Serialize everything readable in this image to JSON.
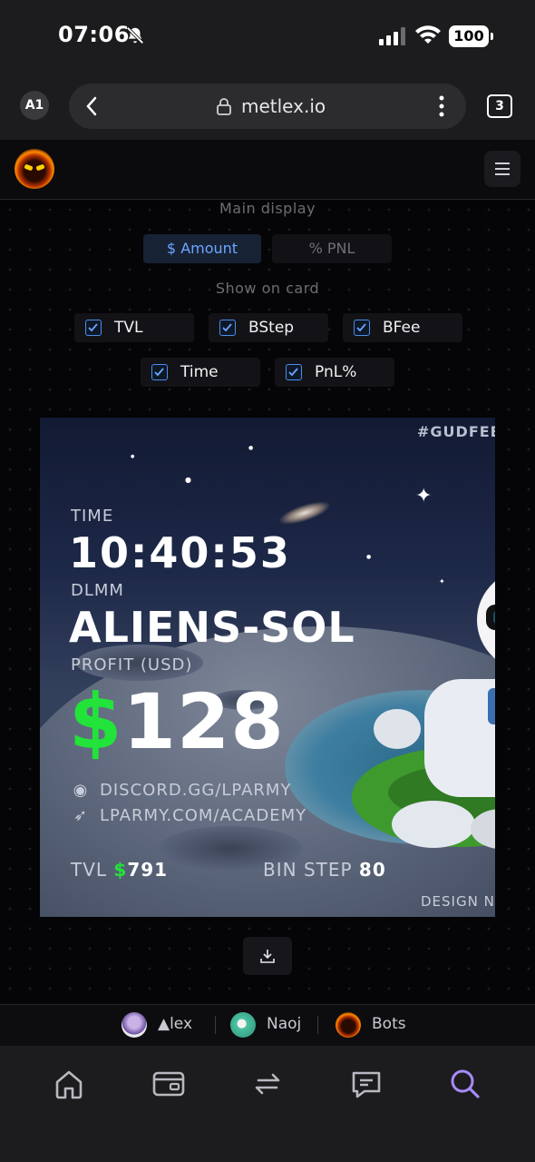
{
  "status_bar": {
    "time": "07:06",
    "battery": "100"
  },
  "browser": {
    "profile": "A1",
    "url": "metlex.io",
    "tab_count": "3"
  },
  "controls": {
    "main_display_label": "Main display",
    "display_modes": [
      "$ Amount",
      "% PNL"
    ],
    "selected_mode": "$ Amount",
    "show_on_card_label": "Show on card",
    "options": [
      {
        "label": "TVL",
        "checked": true
      },
      {
        "label": "BStep",
        "checked": true
      },
      {
        "label": "BFee",
        "checked": true
      },
      {
        "label": "Time",
        "checked": true
      },
      {
        "label": "PnL%",
        "checked": true
      }
    ]
  },
  "card": {
    "hashtag": "#GUDFEE",
    "time_label": "TIME",
    "time_value": "10:40:53",
    "type_label": "DLMM",
    "pair": "ALIENS-SOL",
    "profit_label": "PROFIT (USD)",
    "profit_currency": "$",
    "profit_value": "128",
    "discord": "DISCORD.GG/LPARMY",
    "academy": "LPARMY.COM/ACADEMY",
    "tvl_label": "TVL",
    "tvl_currency": "$",
    "tvl_value": "791",
    "bin_step_label": "BIN STEP",
    "bin_step_value": "80",
    "design_credit": "DESIGN N"
  },
  "credits": [
    {
      "name": "▲lex"
    },
    {
      "name": "Naoj"
    },
    {
      "name": "Bots"
    }
  ],
  "colors": {
    "accent_green": "#22e33a",
    "accent_blue": "#6aa6ff",
    "nav_active": "#a78bfa"
  },
  "bottom_nav": [
    "home-icon",
    "wallet-icon",
    "swap-icon",
    "chat-icon",
    "search-icon"
  ]
}
